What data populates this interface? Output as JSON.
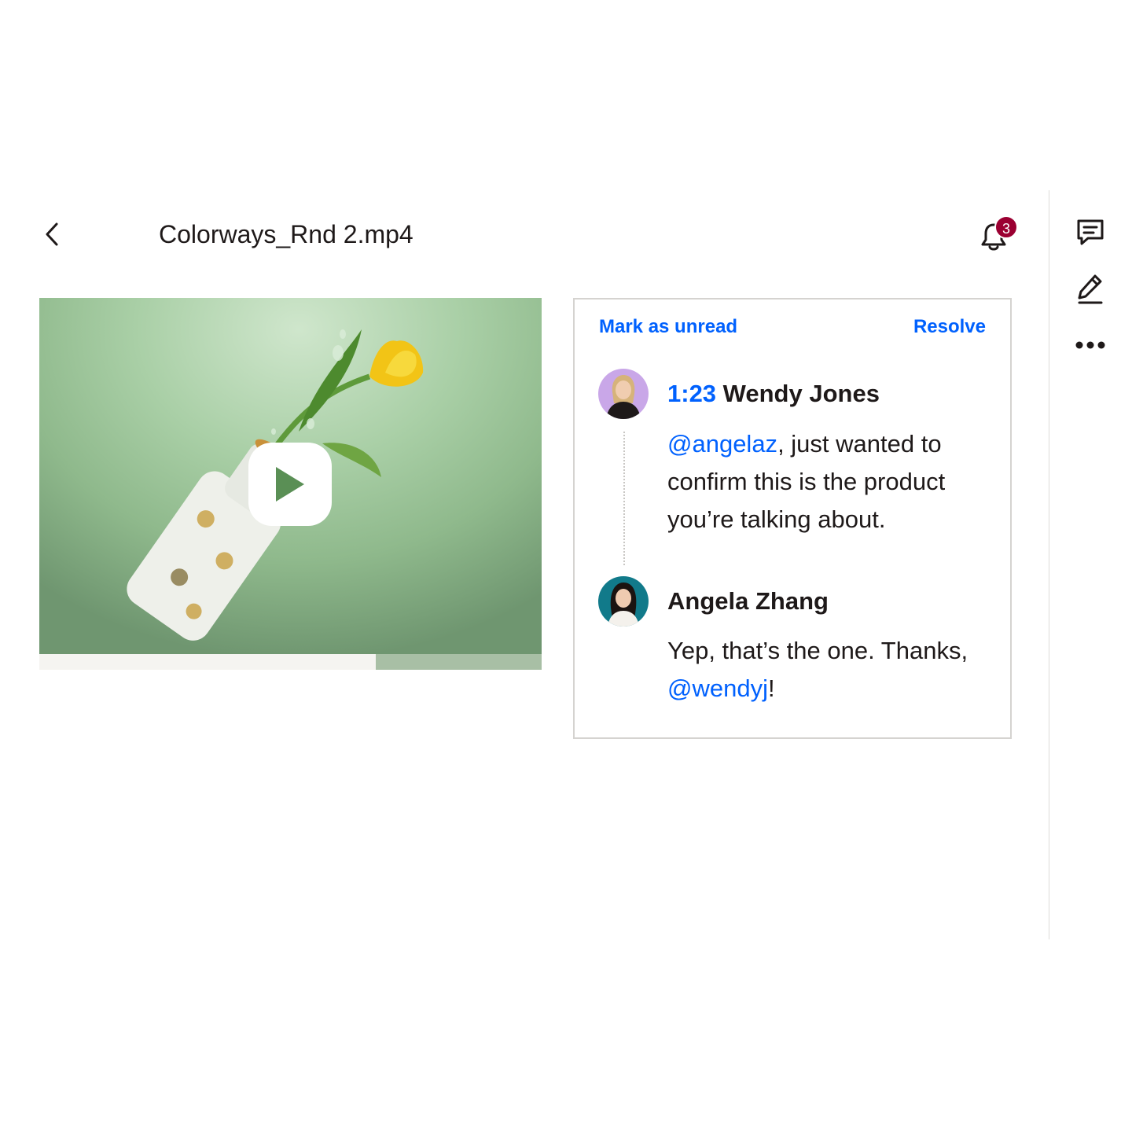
{
  "header": {
    "file_name": "Colorways_Rnd 2.mp4",
    "notification_count": "3"
  },
  "icons": {
    "back": "chevron-left-icon",
    "bell": "bell-icon",
    "comment": "comment-icon",
    "edit": "pencil-icon",
    "more": "more-horizontal-icon",
    "play": "play-icon"
  },
  "video": {
    "progress_played": 0.67
  },
  "comment_card": {
    "mark_unread_label": "Mark as unread",
    "resolve_label": "Resolve",
    "comments": [
      {
        "timestamp": "1:23",
        "author": "Wendy Jones",
        "mention": "@angelaz",
        "text": ", just wanted to confirm this is the product you’re talking about."
      },
      {
        "author": "Angela Zhang",
        "text_before": "Yep, that’s the one. Thanks, ",
        "mention": "@wendyj",
        "text_after": "!"
      }
    ]
  },
  "colors": {
    "accent": "#0061fe",
    "badge": "#9b0032",
    "text": "#1e1919"
  }
}
